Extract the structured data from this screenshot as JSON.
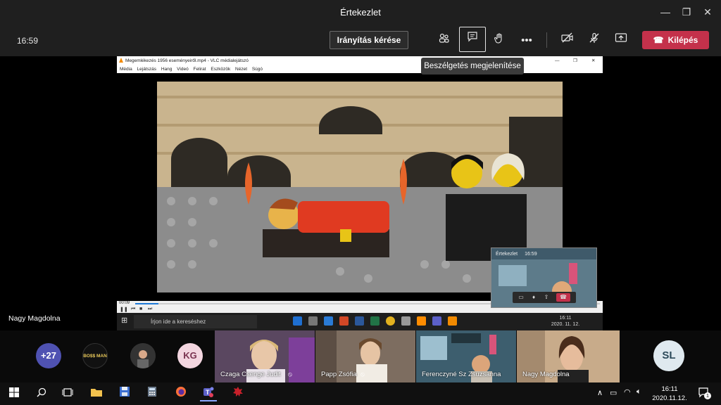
{
  "window": {
    "title": "Értekezlet",
    "minimize": "—",
    "maximize": "❐",
    "close": "✕"
  },
  "toolbar": {
    "elapsed_time": "16:59",
    "request_control_label": "Irányítás kérése",
    "leave_label": "Kilépés",
    "tooltip": "Beszélgetés megjelenítése",
    "icons": [
      "participants-icon",
      "chat-icon",
      "raise-hand-icon",
      "more-options-icon",
      "camera-off-icon",
      "mic-off-icon",
      "share-tray-icon",
      "hangup-icon"
    ],
    "colors": {
      "leave": "#c4314b",
      "bar": "#1f1f1f"
    }
  },
  "shared_screen": {
    "vlc_title": "Megemlékezés 1956 eseményeiről.mp4 - VLC médialejátszó",
    "vlc_menu": [
      "Média",
      "Lejátszás",
      "Hang",
      "Videó",
      "Felirat",
      "Eszközök",
      "Nézet",
      "Súgó"
    ],
    "playback_time": "00:09",
    "playback_progress": 0.05,
    "search_placeholder": "Írjon ide a kereséshez",
    "small_clock_time": "16:11",
    "small_clock_date": "2020. 11. 12.",
    "mini_window_title": "Értekezlet",
    "mini_window_time": "16:59"
  },
  "presenter_name": "Nagy Magdolna",
  "participants": {
    "overflow_count": "+27",
    "avatar_boss": "BO$$ MAN",
    "avatar_kg": "KG",
    "avatar_sl": "SL",
    "tiles": [
      {
        "name": "Czaga Csenge Judit"
      },
      {
        "name": "Papp Zsófia"
      },
      {
        "name": "Ferenczyné Sz Zsuzsanna"
      },
      {
        "name": "Nagy Magdolna"
      }
    ]
  },
  "taskbar": {
    "time": "16:11",
    "date": "2020.11.12.",
    "notification_count": "1"
  }
}
